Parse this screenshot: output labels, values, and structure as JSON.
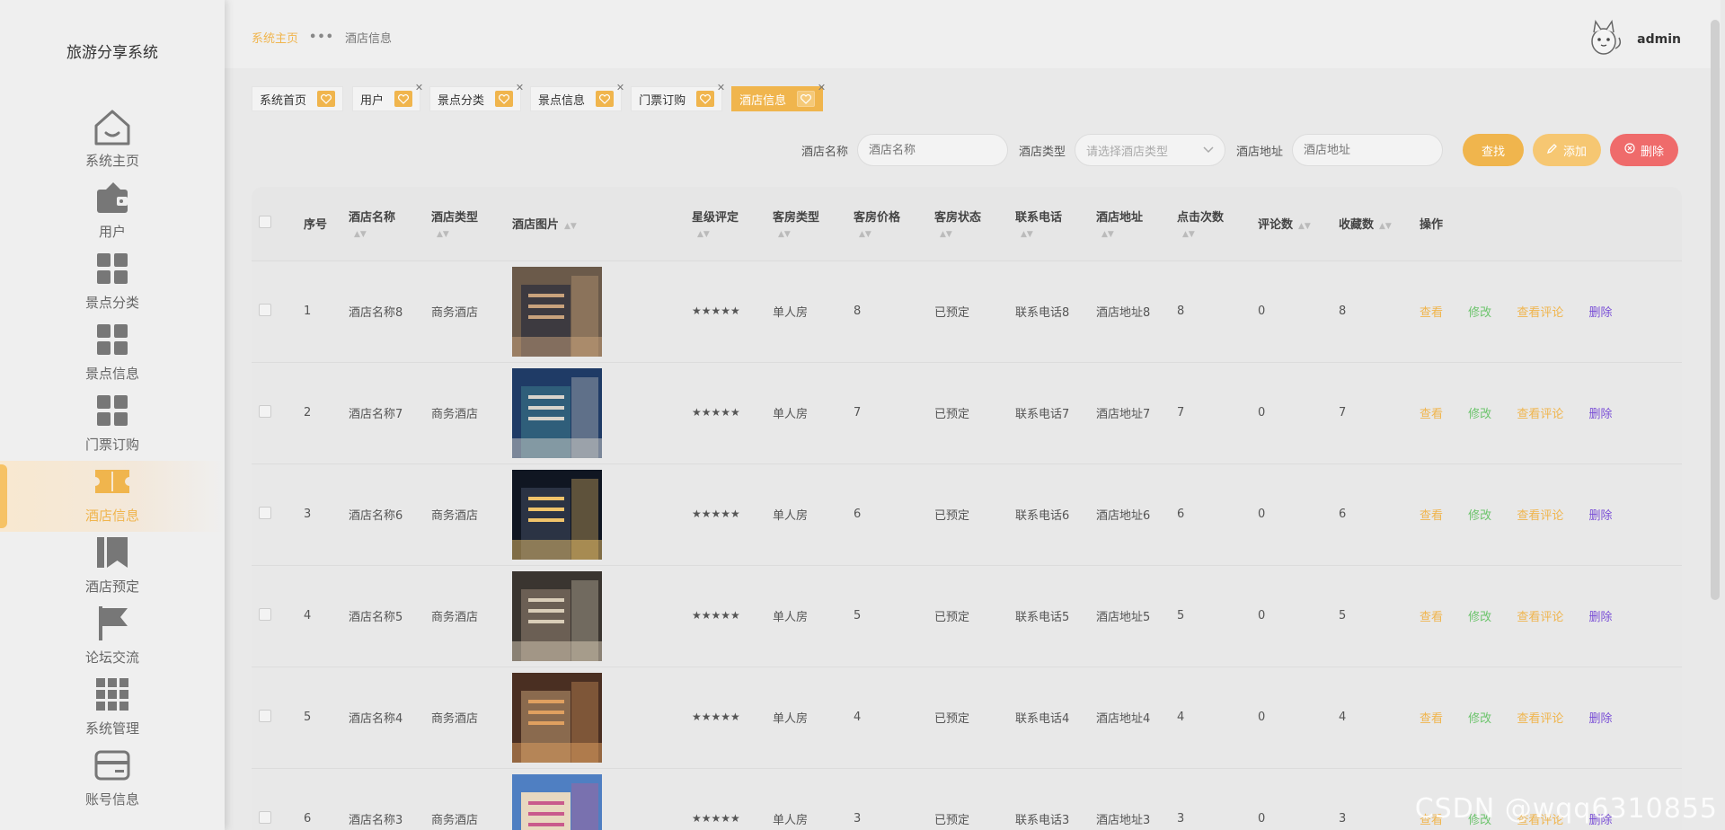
{
  "app": {
    "title": "旅游分享系统"
  },
  "sidebar": {
    "items": [
      {
        "label": "系统主页",
        "icon": "home-icon"
      },
      {
        "label": "用户",
        "icon": "wallet-icon"
      },
      {
        "label": "景点分类",
        "icon": "grid-icon"
      },
      {
        "label": "景点信息",
        "icon": "grid-icon"
      },
      {
        "label": "门票订购",
        "icon": "grid-icon"
      },
      {
        "label": "酒店信息",
        "icon": "ticket-icon",
        "active": true
      },
      {
        "label": "酒店预定",
        "icon": "bookmark-icon"
      },
      {
        "label": "论坛交流",
        "icon": "flag-icon"
      },
      {
        "label": "系统管理",
        "icon": "apps-icon"
      },
      {
        "label": "账号信息",
        "icon": "card-icon"
      }
    ]
  },
  "header": {
    "breadcrumb_home": "系统主页",
    "breadcrumb_current": "酒店信息",
    "username": "admin"
  },
  "tags": [
    {
      "label": "系统首页",
      "closable": false
    },
    {
      "label": "用户",
      "closable": true
    },
    {
      "label": "景点分类",
      "closable": true
    },
    {
      "label": "景点信息",
      "closable": true
    },
    {
      "label": "门票订购",
      "closable": true
    },
    {
      "label": "酒店信息",
      "closable": true,
      "active": true
    }
  ],
  "search": {
    "name_label": "酒店名称",
    "name_placeholder": "酒店名称",
    "type_label": "酒店类型",
    "type_placeholder": "请选择酒店类型",
    "address_label": "酒店地址",
    "address_placeholder": "酒店地址",
    "search_btn": "查找",
    "add_btn": "添加",
    "delete_btn": "删除"
  },
  "table": {
    "columns": [
      "序号",
      "酒店名称",
      "酒店类型",
      "酒店图片",
      "星级评定",
      "客房类型",
      "客房价格",
      "客房状态",
      "联系电话",
      "酒店地址",
      "点击次数",
      "评论数",
      "收藏数",
      "操作"
    ],
    "actions": {
      "view": "查看",
      "edit": "修改",
      "comments": "查看评论",
      "delete": "删除"
    },
    "rows": [
      {
        "no": "1",
        "name": "酒店名称8",
        "type": "商务酒店",
        "stars": "★★★★★",
        "room": "单人房",
        "price": "8",
        "status": "已预定",
        "phone": "联系电话8",
        "address": "酒店地址8",
        "clicks": "8",
        "comments": "0",
        "favorites": "8"
      },
      {
        "no": "2",
        "name": "酒店名称7",
        "type": "商务酒店",
        "stars": "★★★★★",
        "room": "单人房",
        "price": "7",
        "status": "已预定",
        "phone": "联系电话7",
        "address": "酒店地址7",
        "clicks": "7",
        "comments": "0",
        "favorites": "7"
      },
      {
        "no": "3",
        "name": "酒店名称6",
        "type": "商务酒店",
        "stars": "★★★★★",
        "room": "单人房",
        "price": "6",
        "status": "已预定",
        "phone": "联系电话6",
        "address": "酒店地址6",
        "clicks": "6",
        "comments": "0",
        "favorites": "6"
      },
      {
        "no": "4",
        "name": "酒店名称5",
        "type": "商务酒店",
        "stars": "★★★★★",
        "room": "单人房",
        "price": "5",
        "status": "已预定",
        "phone": "联系电话5",
        "address": "酒店地址5",
        "clicks": "5",
        "comments": "0",
        "favorites": "5"
      },
      {
        "no": "5",
        "name": "酒店名称4",
        "type": "商务酒店",
        "stars": "★★★★★",
        "room": "单人房",
        "price": "4",
        "status": "已预定",
        "phone": "联系电话4",
        "address": "酒店地址4",
        "clicks": "4",
        "comments": "0",
        "favorites": "4"
      },
      {
        "no": "6",
        "name": "酒店名称3",
        "type": "商务酒店",
        "stars": "★★★★★",
        "room": "单人房",
        "price": "3",
        "status": "已预定",
        "phone": "联系电话3",
        "address": "酒店地址3",
        "clicks": "3",
        "comments": "0",
        "favorites": "3"
      }
    ]
  },
  "watermark": "CSDN @wqq6310855",
  "colors": {
    "accent": "#f0b54d",
    "danger": "#ef6b6b",
    "edit": "#6cc46c",
    "delete_link": "#7a4fd6"
  }
}
